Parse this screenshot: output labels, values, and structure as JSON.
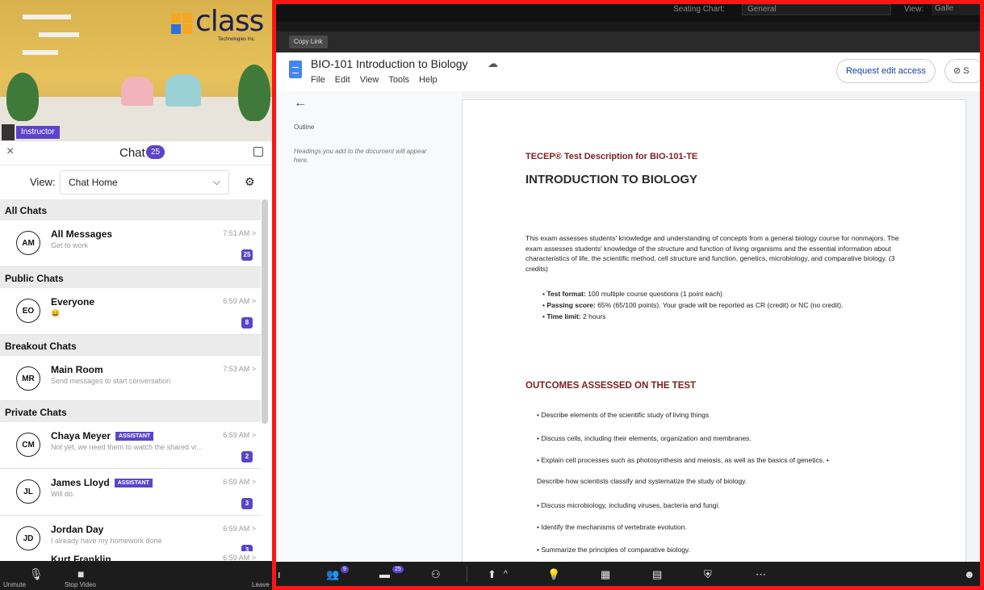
{
  "video": {
    "logo_word": "class",
    "logo_sub": "Technologies Inc.",
    "instructor_label": "Instructor"
  },
  "chat": {
    "title": "Chat",
    "badge": "25",
    "view_label": "View:",
    "view_value": "Chat Home",
    "sections": {
      "all": "All Chats",
      "public": "Public Chats",
      "breakout": "Breakout Chats",
      "private": "Private Chats"
    },
    "items": [
      {
        "initials": "AM",
        "name": "All Messages",
        "sub": "Get to work",
        "time": "7:51 AM >",
        "count": "25"
      },
      {
        "initials": "EO",
        "name": "Everyone",
        "sub": "😄",
        "time": "6:59 AM >",
        "count": "8"
      },
      {
        "initials": "MR",
        "name": "Main Room",
        "sub": "Send messages to start conversation",
        "time": "7:53 AM >",
        "count": ""
      },
      {
        "initials": "CM",
        "name": "Chaya Meyer",
        "tag": "ASSISTANT",
        "sub": "Not yet, we need them to watch the shared vi...",
        "time": "6:59 AM >",
        "count": "2"
      },
      {
        "initials": "JL",
        "name": "James Lloyd",
        "tag": "ASSISTANT",
        "sub": "Will do.",
        "time": "6:59 AM >",
        "count": "3"
      },
      {
        "initials": "JD",
        "name": "Jordan Day",
        "sub": "I already have my homework done",
        "time": "6:59 AM >",
        "count": "3"
      },
      {
        "initials": "KF",
        "name": "Kurt Franklin",
        "sub": "",
        "time": "6:59 AM >",
        "count": ""
      }
    ]
  },
  "left_toolbar": {
    "unmute": "Unmute",
    "stop_video": "Stop Video",
    "leave": "Leave"
  },
  "top_bar": {
    "seating_chart_label": "Seating Chart:",
    "seating_chart_value": "General",
    "view_label": "View:",
    "view_value": "Galle"
  },
  "copy_link": "Copy Link",
  "doc": {
    "title": "BIO-101 Introduction to Biology",
    "menus": [
      "File",
      "Edit",
      "View",
      "Tools",
      "Help"
    ],
    "request_edit": "Request edit access",
    "share": "S",
    "outline_title": "Outline",
    "outline_hint": "Headings you add to the document will appear here.",
    "heading1": "TECEP® Test Description for BIO-101-TE",
    "heading2": "INTRODUCTION TO BIOLOGY",
    "paragraph": "This exam assesses students' knowledge and understanding of concepts from a general biology course for nonmajors. The exam assesses students' knowledge of the structure and function of living organisms and the essential information about characteristics of life, the scientific method, cell structure and function, genetics, microbiology, and comparative biology. (3 credits)",
    "bullets": [
      {
        "label": "Test format:",
        "text": " 100 multiple course questions (1 point each)"
      },
      {
        "label": "Passing score:",
        "text": " 65% (65/100 points). Your grade will be reported as CR (credit) or NC (no credit)."
      },
      {
        "label": "Time limit:",
        "text": " 2 hours"
      }
    ],
    "heading3": "OUTCOMES ASSESSED ON THE TEST",
    "outcomes": [
      "• Describe elements of the scientific study of living things",
      "• Discuss cells, including their elements, organization and membranes.",
      "• Explain cell processes such as photosynthesis and meiosis, as well as the basics of genetics. •",
      "Describe how scientists classify and systematize the study of biology.",
      "• Discuss microbiology, including viruses, bacteria and fungi.",
      "• Identify the mechanisms of vertebrate evolution.",
      "• Summarize the principles of comparative biology."
    ]
  },
  "zoom_bar": {
    "participants_badge": "9",
    "chat_badge": "25"
  },
  "colors": {
    "accent": "#5b44c9",
    "highlight_border": "#ff1515",
    "heading_red": "#7a1f1f",
    "link_blue": "#1a3fa8"
  }
}
